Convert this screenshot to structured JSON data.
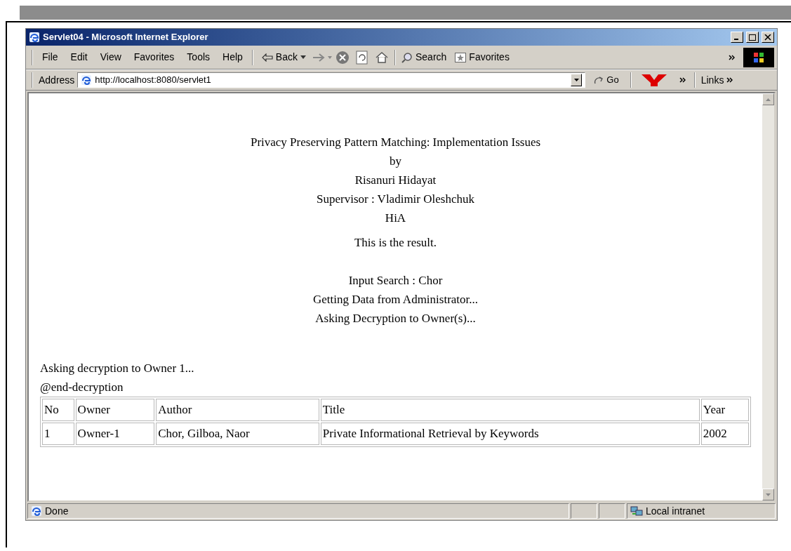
{
  "window": {
    "title": "Servlet04 - Microsoft Internet Explorer"
  },
  "menu": [
    "File",
    "Edit",
    "View",
    "Favorites",
    "Tools",
    "Help"
  ],
  "toolbar": {
    "back": "Back",
    "search": "Search",
    "favorites": "Favorites"
  },
  "address": {
    "label": "Address",
    "url": "http://localhost:8080/servlet1",
    "go": "Go",
    "links": "Links"
  },
  "page": {
    "heading_lines": [
      "Privacy Preserving Pattern Matching: Implementation Issues",
      "by",
      "Risanuri Hidayat",
      "Supervisor : Vladimir Oleshchuk",
      "HiA"
    ],
    "result": "This is the result.",
    "status_lines": [
      "Input Search : Chor",
      "Getting Data from Administrator...",
      "Asking Decryption to Owner(s)..."
    ],
    "log_lines": [
      "Asking decryption to Owner 1...",
      "@end-decryption"
    ],
    "table": {
      "columns": [
        "No",
        "Owner",
        "Author",
        "Title",
        "Year"
      ],
      "rows": [
        [
          "1",
          "Owner-1",
          "Chor, Gilboa, Naor",
          "Private Informational Retrieval by Keywords",
          "2002"
        ]
      ]
    }
  },
  "status_bar": {
    "text": "Done",
    "zone": "Local intranet"
  }
}
